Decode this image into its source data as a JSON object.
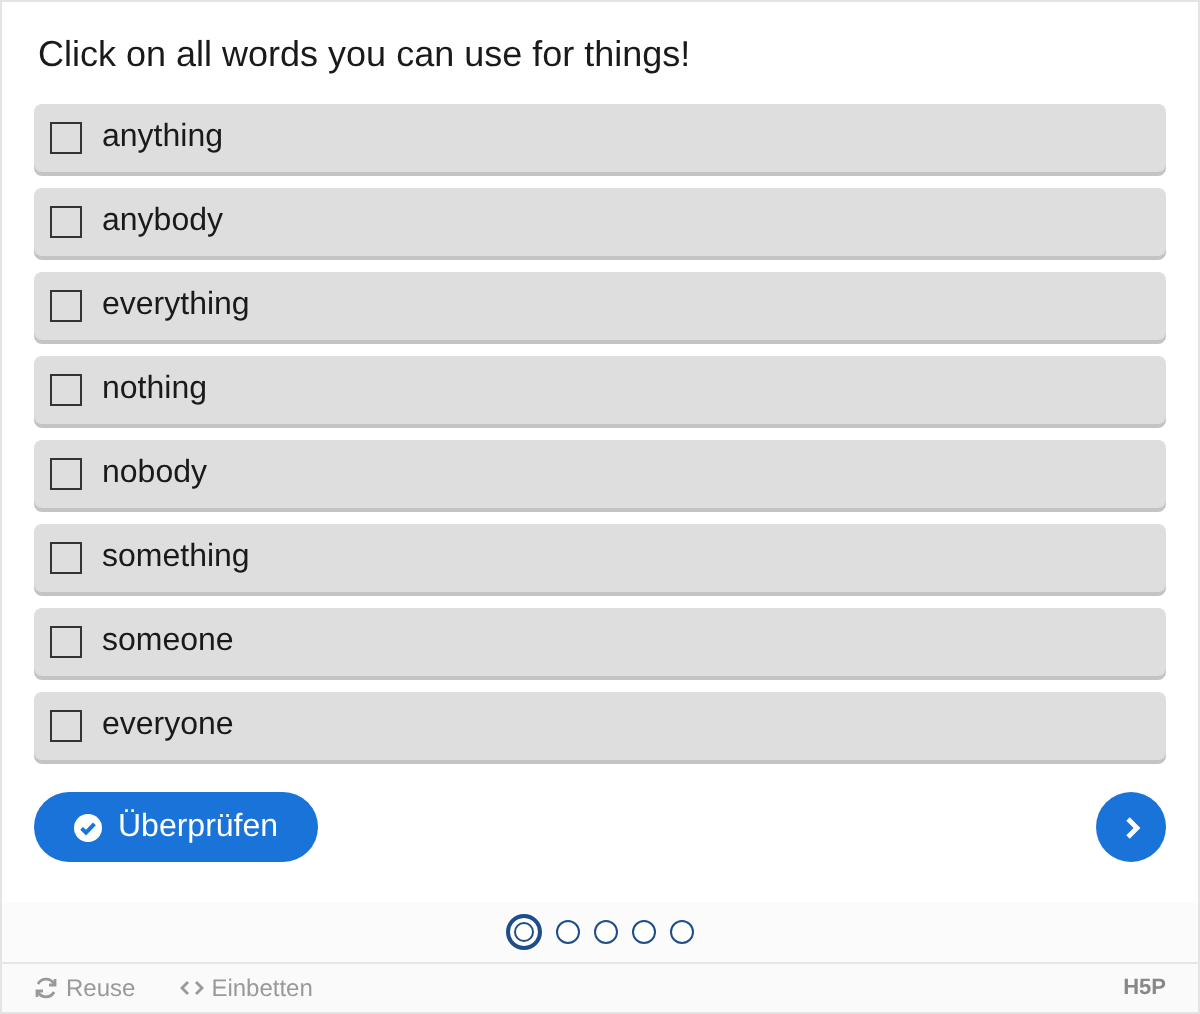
{
  "question": "Click on all words you can use for things!",
  "options": [
    {
      "label": "anything",
      "checked": false
    },
    {
      "label": "anybody",
      "checked": false
    },
    {
      "label": "everything",
      "checked": false
    },
    {
      "label": "nothing",
      "checked": false
    },
    {
      "label": "nobody",
      "checked": false
    },
    {
      "label": "something",
      "checked": false
    },
    {
      "label": "someone",
      "checked": false
    },
    {
      "label": "everyone",
      "checked": false
    }
  ],
  "check_button": "Überprüfen",
  "pages": [
    {
      "selected": true
    },
    {
      "selected": false
    },
    {
      "selected": false
    },
    {
      "selected": false
    },
    {
      "selected": false
    }
  ],
  "footer": {
    "reuse": "Reuse",
    "embed": "Einbetten",
    "logo": "H5P"
  }
}
